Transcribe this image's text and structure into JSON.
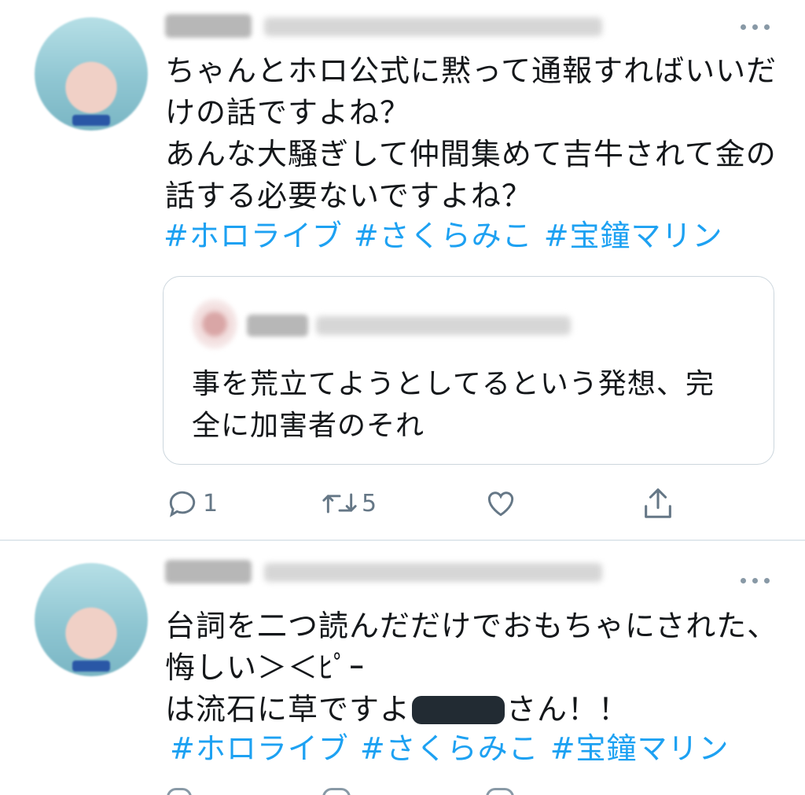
{
  "tweets": [
    {
      "lines": [
        "ちゃんとホロ公式に黙って通報すればいいだ",
        "けの話ですよね？",
        "あんな大騒ぎして仲間集めて吉牛されて金の",
        "話する必要ないですよね？"
      ],
      "hashtags": [
        "#ホロライブ",
        "#さくらみこ",
        "#宝鐘マリン"
      ],
      "quote": {
        "lines": [
          "事を荒立てようとしてるという発想、完",
          "全に加害者のそれ"
        ]
      },
      "actions": {
        "reply_count": "1",
        "retweet_count": "5",
        "like_count": "",
        "share_count": ""
      }
    },
    {
      "lines": [
        "台詞を二つ読んだだけでおもちゃにされた、",
        "悔しい＞＜ﾋﾟｰ"
      ],
      "line3_before": "は流石に草ですよ",
      "line3_after": "さん！！",
      "hashtags": [
        "#ホロライブ",
        "#さくらみこ",
        "#宝鐘マリン"
      ]
    }
  ],
  "colors": {
    "hashtag": "#1da1f2",
    "icon": "#657786",
    "border": "#ccd6dd"
  }
}
